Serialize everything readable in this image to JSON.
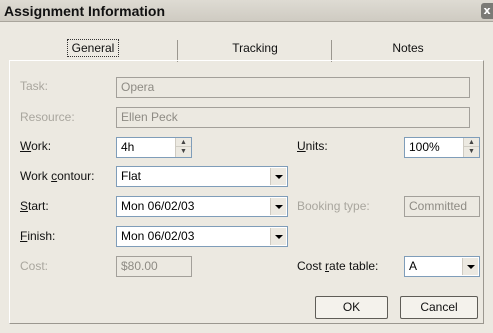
{
  "window": {
    "title": "Assignment Information",
    "close_label": "x"
  },
  "tabs": [
    {
      "label": "General",
      "active": true
    },
    {
      "label": "Tracking",
      "active": false
    },
    {
      "label": "Notes",
      "active": false
    }
  ],
  "form": {
    "task": {
      "label": "Task:",
      "value": "Opera"
    },
    "resource": {
      "label": "Resource:",
      "value": "Ellen Peck"
    },
    "work": {
      "label_pre": "",
      "label_u": "W",
      "label_post": "ork:",
      "value": "4h"
    },
    "units": {
      "label_pre": "",
      "label_u": "U",
      "label_post": "nits:",
      "value": "100%"
    },
    "work_contour": {
      "label_pre": "Work ",
      "label_u": "c",
      "label_post": "ontour:",
      "value": "Flat"
    },
    "start": {
      "label_pre": "",
      "label_u": "S",
      "label_post": "tart:",
      "value": "Mon 06/02/03"
    },
    "booking_type": {
      "label": "Booking type:",
      "value": "Committed"
    },
    "finish": {
      "label_pre": "",
      "label_u": "F",
      "label_post": "inish:",
      "value": "Mon 06/02/03"
    },
    "cost": {
      "label": "Cost:",
      "value": "$80.00"
    },
    "cost_rate_table": {
      "label_pre": "Cost ",
      "label_u": "r",
      "label_post": "ate table:",
      "value": "A"
    }
  },
  "buttons": {
    "ok": "OK",
    "cancel": "Cancel"
  },
  "spinner": {
    "up": "▲",
    "down": "▼"
  }
}
